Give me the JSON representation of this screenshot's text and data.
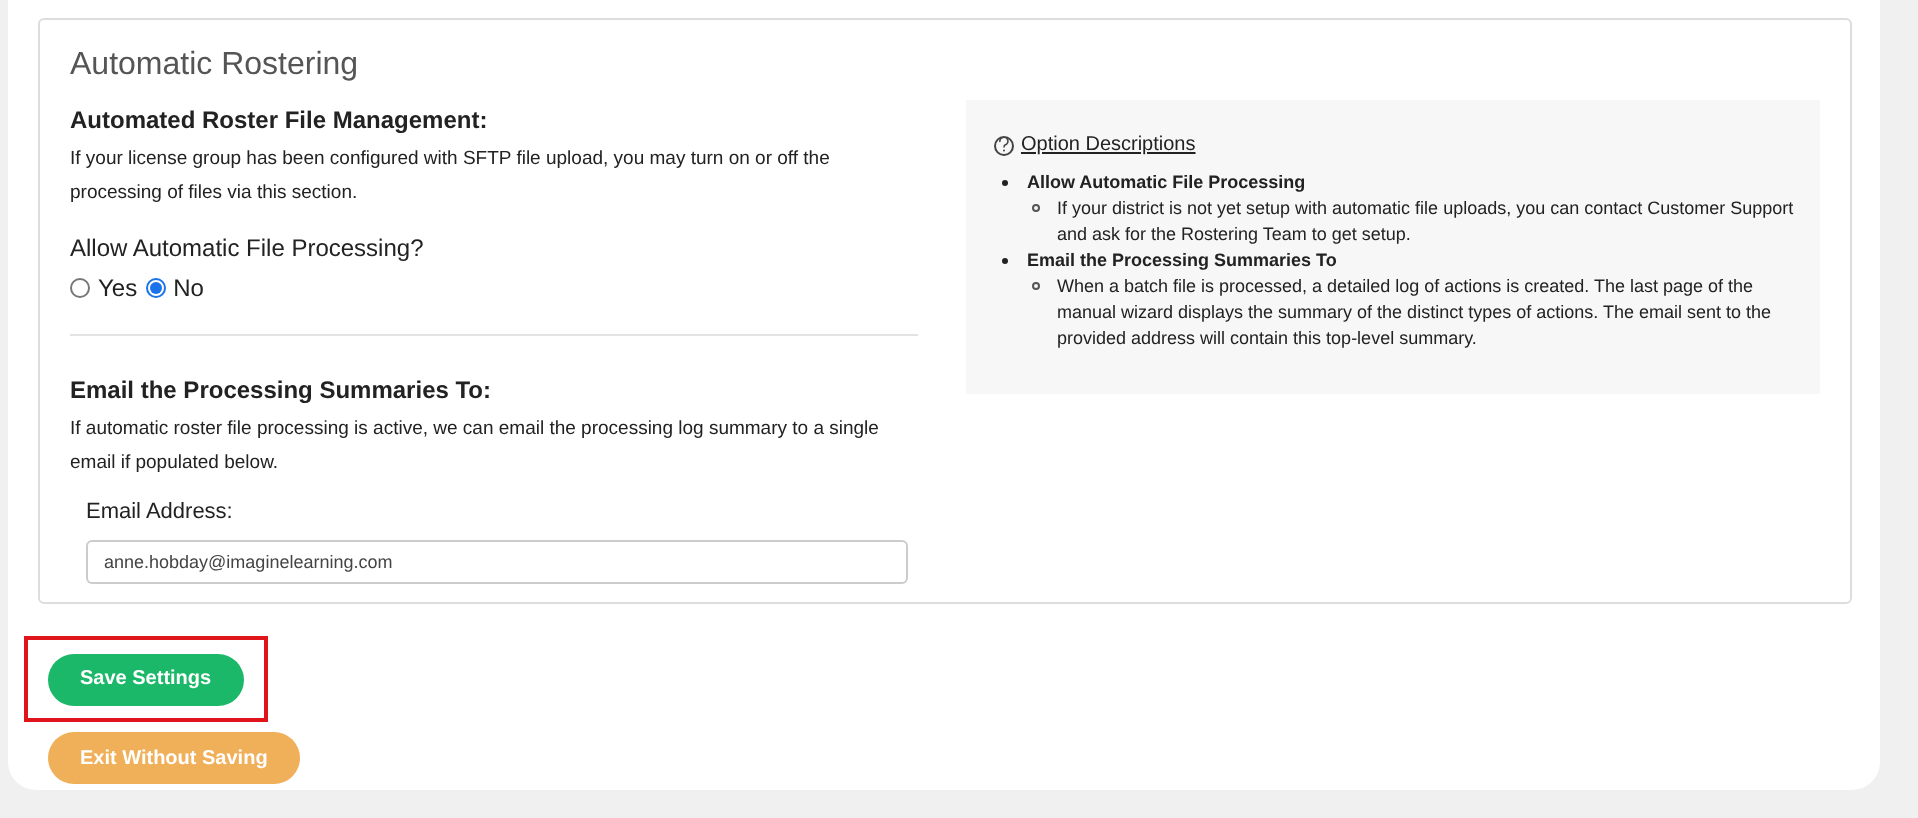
{
  "section": {
    "title": "Automatic Rostering"
  },
  "management": {
    "heading": "Automated Roster File Management:",
    "description": "If your license group has been configured with SFTP file upload, you may turn on or off the processing of files via this section."
  },
  "processing": {
    "label": "Allow Automatic File Processing?",
    "options": [
      {
        "label": "Yes",
        "selected": false
      },
      {
        "label": "No",
        "selected": true
      }
    ]
  },
  "email": {
    "heading": "Email the Processing Summaries To:",
    "description": "If automatic roster file processing is active, we can email the processing log summary to a single email if populated below.",
    "field_label": "Email Address:",
    "value": "anne.hobday@imaginelearning.com"
  },
  "option_descriptions": {
    "title": "Option Descriptions",
    "items": [
      {
        "title": "Allow Automatic File Processing",
        "details": [
          "If your district is not yet setup with automatic file uploads, you can contact Customer Support and ask for the Rostering Team to get setup."
        ]
      },
      {
        "title": "Email the Processing Summaries To",
        "details": [
          "When a batch file is processed, a detailed log of actions is created. The last page of the manual wizard displays the summary of the distinct types of actions. The email sent to the provided address will contain this top-level summary."
        ]
      }
    ]
  },
  "buttons": [
    {
      "label": "Save Settings",
      "kind": "primary",
      "highlighted": true
    },
    {
      "label": "Exit Without Saving",
      "kind": "secondary",
      "highlighted": false
    }
  ]
}
